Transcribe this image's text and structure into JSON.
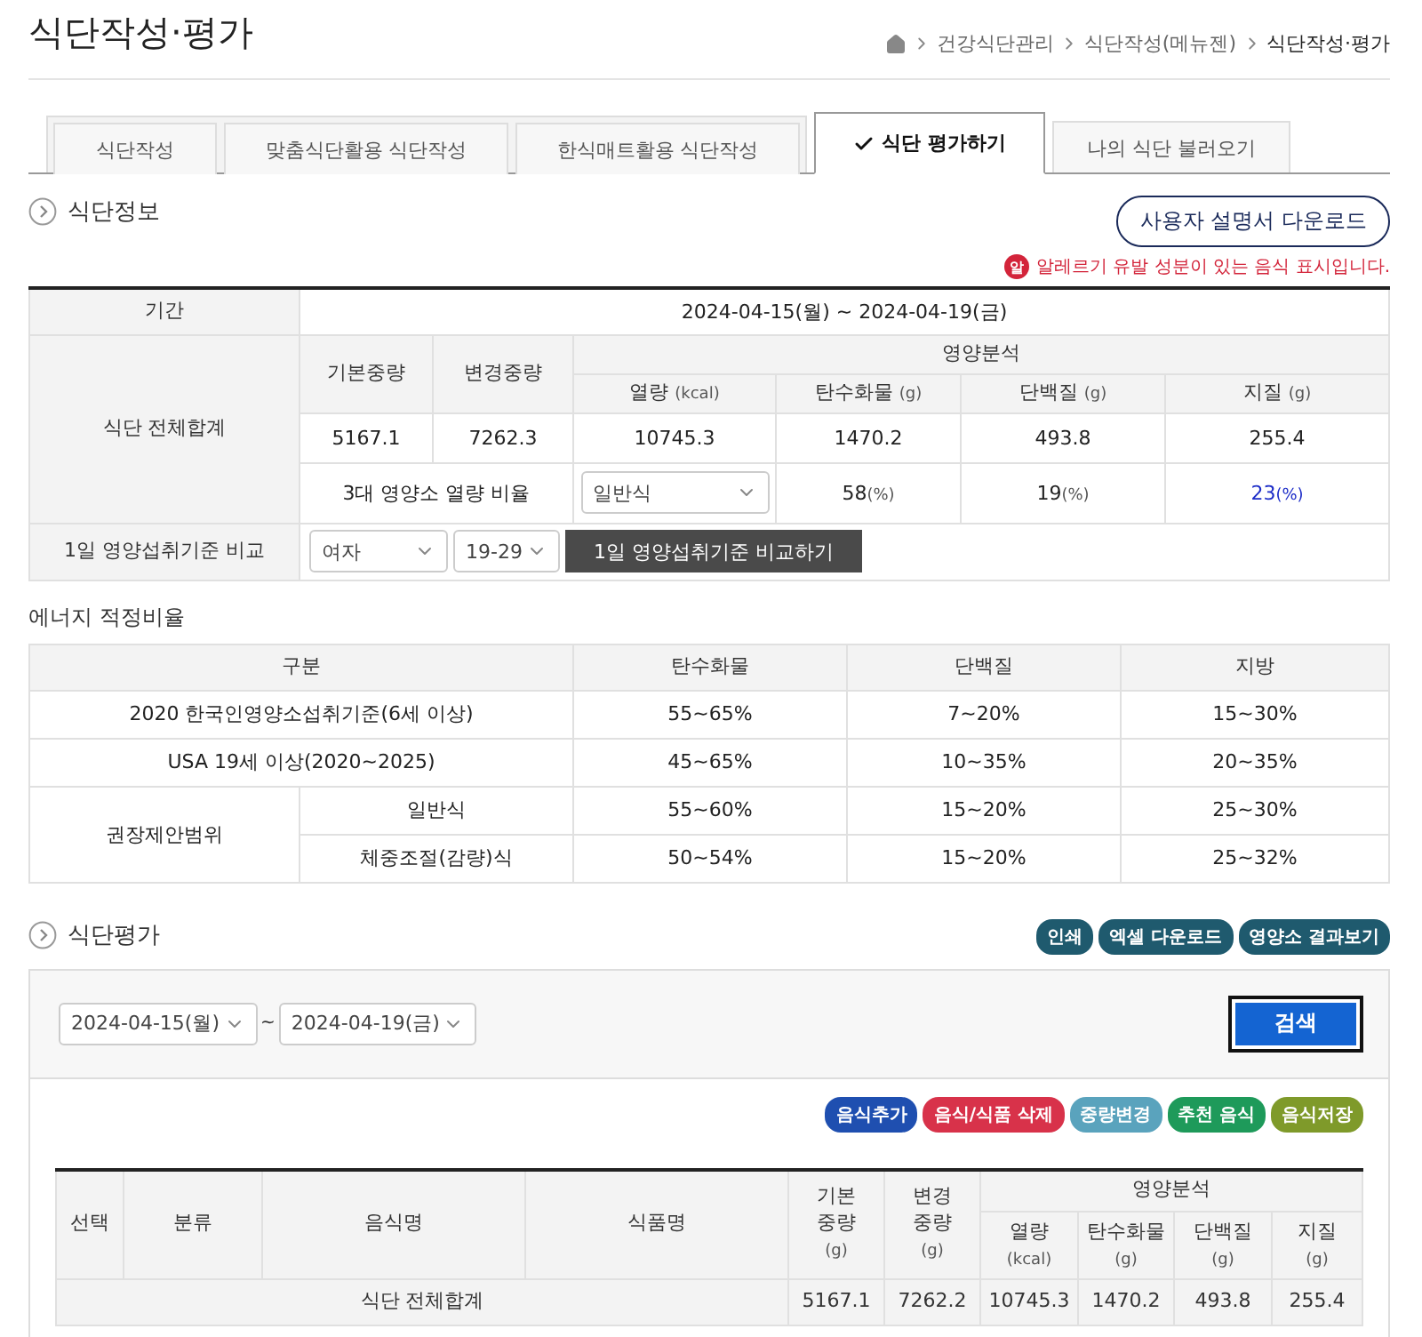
{
  "page_title": "식단작성·평가",
  "breadcrumb": [
    "건강식단관리",
    "식단작성(메뉴젠)",
    "식단작성·평가"
  ],
  "tabs": [
    {
      "label": "식단작성",
      "selected": false
    },
    {
      "label": "맞춤식단활용 식단작성",
      "selected": false
    },
    {
      "label": "한식매트활용 식단작성",
      "selected": false
    },
    {
      "label": "식단 평가하기",
      "selected": true
    },
    {
      "label": "나의 식단 불러오기",
      "selected": false
    }
  ],
  "diet_info": {
    "heading": "식단정보",
    "manual_button": "사용자 설명서 다운로드",
    "allergy_badge": "알",
    "allergy_note": "알레르기 유발 성분이 있는 음식 표시입니다.",
    "period_label": "기간",
    "period": "2024-04-15(월) ~ 2024-04-19(금)",
    "total_label": "식단 전체합계",
    "base_weight_label": "기본중량",
    "changed_weight_label": "변경중량",
    "analysis_label": "영양분석",
    "nutrients": [
      {
        "name": "열량",
        "unit": "(kcal)",
        "value": "10745.3"
      },
      {
        "name": "탄수화물",
        "unit": "(g)",
        "value": "1470.2"
      },
      {
        "name": "단백질",
        "unit": "(g)",
        "value": "493.8"
      },
      {
        "name": "지질",
        "unit": "(g)",
        "value": "255.4"
      }
    ],
    "base_weight": "5167.1",
    "changed_weight": "7262.3",
    "ratio_label": "3대 영양소 열량 비율",
    "ratio_select": "일반식",
    "ratios": [
      {
        "value": "58",
        "unit": "(%)",
        "highlighted": false
      },
      {
        "value": "19",
        "unit": "(%)",
        "highlighted": false
      },
      {
        "value": "23",
        "unit": "(%)",
        "highlighted": true
      }
    ],
    "compare_label": "1일 영양섭취기준 비교",
    "gender_select": "여자",
    "age_select": "19-29",
    "compare_button": "1일 영양섭취기준 비교하기"
  },
  "energy": {
    "heading": "에너지 적정비율",
    "columns": [
      "구분",
      "탄수화물",
      "단백질",
      "지방"
    ],
    "rows": [
      {
        "label": "2020 한국인영양소섭취기준(6세 이상)",
        "values": [
          "55~65%",
          "7~20%",
          "15~30%"
        ]
      },
      {
        "label": "USA 19세 이상(2020~2025)",
        "values": [
          "45~65%",
          "10~35%",
          "20~35%"
        ]
      }
    ],
    "group_label": "권장제안범위",
    "group_rows": [
      {
        "label": "일반식",
        "values": [
          "55~60%",
          "15~20%",
          "25~30%"
        ]
      },
      {
        "label": "체중조절(감량)식",
        "values": [
          "50~54%",
          "15~20%",
          "25~32%"
        ]
      }
    ]
  },
  "evaluation": {
    "heading": "식단평가",
    "top_buttons": [
      "인쇄",
      "엑셀 다운로드",
      "영양소 결과보기"
    ],
    "start_date": "2024-04-15(월)",
    "date_separator": "~",
    "end_date": "2024-04-19(금)",
    "search_button": "검색",
    "actions": [
      {
        "label": "음식추가",
        "color": "#1f4fb0"
      },
      {
        "label": "음식/식품 삭제",
        "color": "#d8324a"
      },
      {
        "label": "중량변경",
        "color": "#5aa3bd"
      },
      {
        "label": "추천 음식",
        "color": "#1e9a5a"
      },
      {
        "label": "음식저장",
        "color": "#7f9a2a"
      }
    ],
    "columns": [
      "선택",
      "분류",
      "음식명",
      "식품명"
    ],
    "weight_columns": [
      {
        "name": "기본\n중량",
        "unit": "(g)"
      },
      {
        "name": "변경\n중량",
        "unit": "(g)"
      }
    ],
    "analysis_label": "영양분석",
    "nutrient_columns": [
      {
        "name": "열량",
        "unit": "(kcal)"
      },
      {
        "name": "탄수화물",
        "unit": "(g)"
      },
      {
        "name": "단백질",
        "unit": "(g)"
      },
      {
        "name": "지질",
        "unit": "(g)"
      }
    ],
    "total_label": "식단 전체합계",
    "total_values": [
      "5167.1",
      "7262.2",
      "10745.3",
      "1470.2",
      "493.8",
      "255.4"
    ]
  }
}
